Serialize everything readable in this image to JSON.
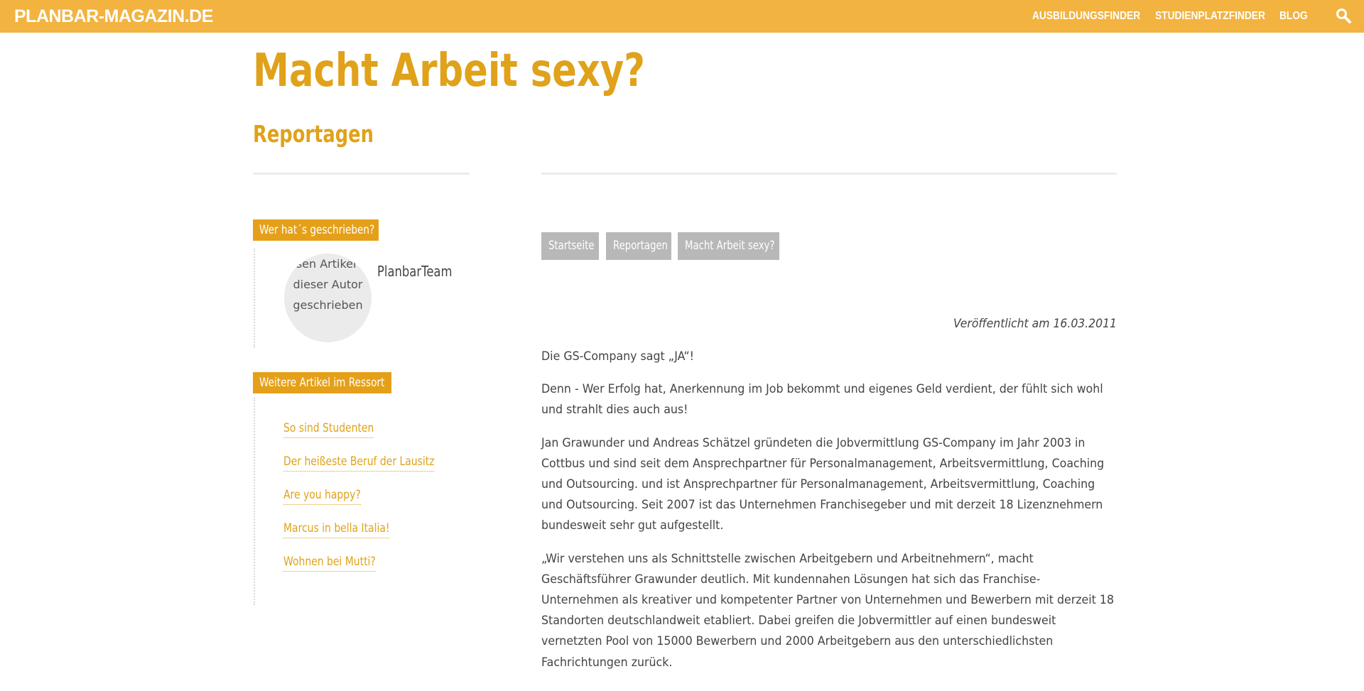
{
  "header": {
    "logo": "PLANBAR-MAGAZIN.DE",
    "nav": [
      "AUSBILDUNGSFINDER",
      "STUDIENPLATZFINDER",
      "BLOG"
    ],
    "search_icon": "search-icon"
  },
  "page": {
    "title": "Macht Arbeit sexy?",
    "section": "Reportagen"
  },
  "sidebar": {
    "author_heading": "Wer hat´s geschrieben?",
    "avatar_alt": "Diesen Artikel hat dieser Autor geschrieben",
    "author_name": "PlanbarTeam",
    "more_heading": "Weitere Artikel im Ressort",
    "more_articles": [
      "So sind Studenten",
      "Der heißeste Beruf der Lausitz",
      "Are you happy?",
      "Marcus in bella Italia!",
      "Wohnen bei Mutti?"
    ]
  },
  "breadcrumb": [
    "Startseite",
    "Reportagen",
    "Macht Arbeit sexy?"
  ],
  "article": {
    "published": "Veröffentlicht am 16.03.2011",
    "paragraphs": [
      "Die GS-Company sagt „JA“!",
      "Denn - Wer Erfolg hat, Anerkennung im Job bekommt und eigenes Geld verdient, der fühlt sich wohl und strahlt dies auch aus!",
      "Jan Grawunder und Andreas Schätzel gründeten die Jobvermittlung GS-Company im Jahr 2003 in Cottbus und sind seit dem Ansprechpartner für Personalmanagement, Arbeitsvermittlung, Coaching und Outsourcing. und ist Ansprechpartner für Personalmanagement, Arbeitsvermittlung, Coaching und Outsourcing. Seit 2007 ist das Unternehmen Franchisegeber und mit derzeit 18 Lizenznehmern bundesweit sehr gut aufgestellt.",
      "„Wir verstehen uns als Schnittstelle zwischen Arbeitgebern und Arbeitnehmern“, macht Geschäftsführer Grawunder deutlich. Mit kundennahen Lösungen hat sich das Franchise-Unternehmen als kreativer und kompetenter Partner von Unternehmen und Bewerbern mit derzeit 18 Standorten deutschlandweit etabliert. Dabei greifen die Jobvermittler auf einen bundesweit vernetzten Pool von 15000 Bewerbern und 2000 Arbeitgebern aus den unterschiedlichsten Fachrichtungen zurück."
    ]
  },
  "colors": {
    "header_bg": "#f2b340",
    "accent": "#e0a21a",
    "tag_bg": "#e5a019",
    "breadcrumb_bg": "#b8b8b8"
  }
}
